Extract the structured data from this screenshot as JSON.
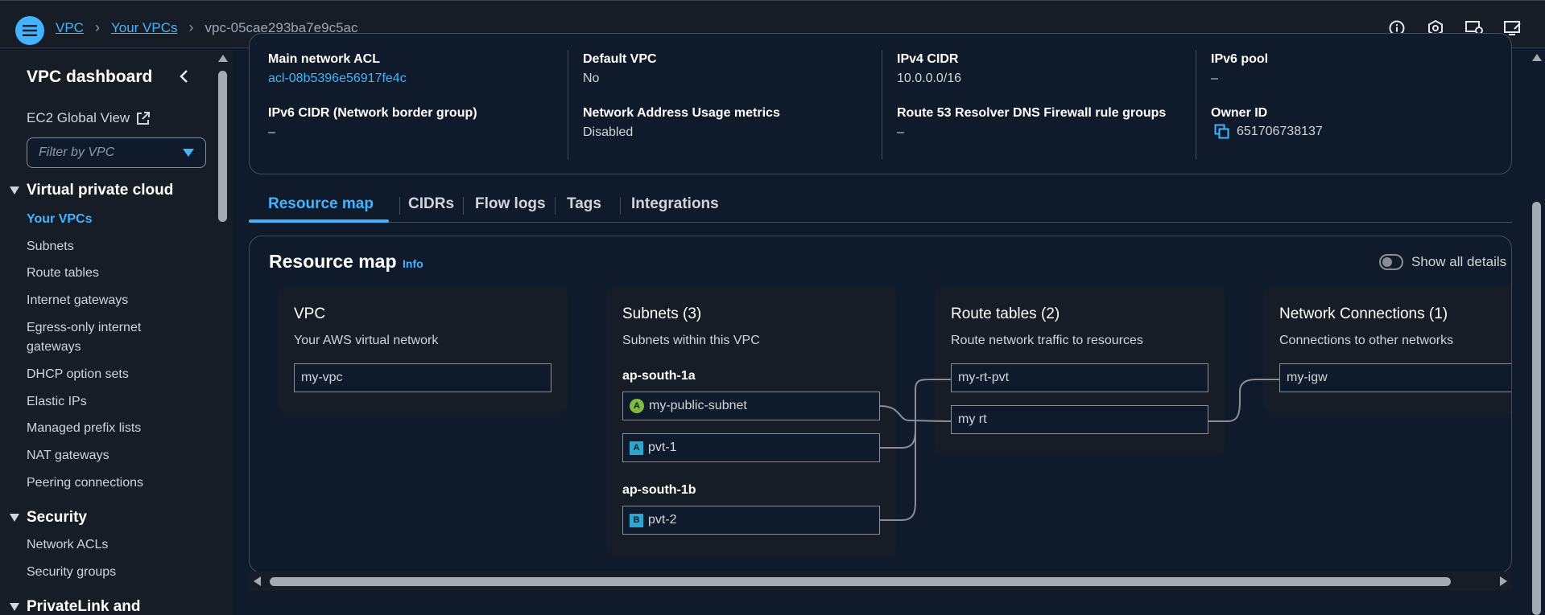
{
  "breadcrumb": {
    "items": [
      "VPC",
      "Your VPCs"
    ],
    "current": "vpc-05cae293ba7e9c5ac"
  },
  "top_icons": [
    "info-icon",
    "shield-settings-icon",
    "support-icon",
    "preferences-icon"
  ],
  "sidebar": {
    "title": "VPC dashboard",
    "ec2_global": "EC2 Global View",
    "filter_placeholder": "Filter by VPC",
    "sections": [
      {
        "title": "Virtual private cloud",
        "items": [
          "Your VPCs",
          "Subnets",
          "Route tables",
          "Internet gateways",
          "Egress-only internet gateways",
          "DHCP option sets",
          "Elastic IPs",
          "Managed prefix lists",
          "NAT gateways",
          "Peering connections"
        ]
      },
      {
        "title": "Security",
        "items": [
          "Network ACLs",
          "Security groups"
        ]
      },
      {
        "title": "PrivateLink and",
        "items": []
      }
    ],
    "active_item": "Your VPCs"
  },
  "details": {
    "main_acl": {
      "label": "Main network ACL",
      "value": "acl-08b5396e56917fe4c"
    },
    "default_vpc": {
      "label": "Default VPC",
      "value": "No"
    },
    "ipv4_cidr": {
      "label": "IPv4 CIDR",
      "value": "10.0.0.0/16"
    },
    "ipv6_pool": {
      "label": "IPv6 pool",
      "value": "–"
    },
    "ipv6_cidr": {
      "label": "IPv6 CIDR (Network border group)",
      "value": "–"
    },
    "nau_metrics": {
      "label": "Network Address Usage metrics",
      "value": "Disabled"
    },
    "route53": {
      "label": "Route 53 Resolver DNS Firewall rule groups",
      "value": "–"
    },
    "owner_id": {
      "label": "Owner ID",
      "value": "651706738137"
    }
  },
  "tabs": [
    "Resource map",
    "CIDRs",
    "Flow logs",
    "Tags",
    "Integrations"
  ],
  "active_tab": "Resource map",
  "resource_map": {
    "title": "Resource map",
    "info": "Info",
    "toggle_label": "Show all details",
    "toggle_on": false,
    "vpc": {
      "title": "VPC",
      "desc": "Your AWS virtual network",
      "name": "my-vpc"
    },
    "subnets": {
      "title": "Subnets (3)",
      "desc": "Subnets within this VPC",
      "zones": [
        {
          "name": "ap-south-1a",
          "subnets": [
            {
              "badge": "A",
              "name": "my-public-subnet",
              "public": true
            },
            {
              "badge": "A",
              "name": "pvt-1",
              "public": false
            }
          ]
        },
        {
          "name": "ap-south-1b",
          "subnets": [
            {
              "badge": "B",
              "name": "pvt-2",
              "public": false
            }
          ]
        }
      ]
    },
    "route_tables": {
      "title": "Route tables (2)",
      "desc": "Route network traffic to resources",
      "items": [
        "my-rt-pvt",
        "my rt"
      ]
    },
    "network_connections": {
      "title": "Network Connections (1)",
      "desc": "Connections to other networks",
      "items": [
        "my-igw"
      ]
    }
  },
  "colors": {
    "accent": "#42b4ff",
    "bg": "#0f1b2a",
    "panel": "#161d26",
    "public_badge": "#7fba42",
    "private_badge": "#2ea7d0"
  }
}
